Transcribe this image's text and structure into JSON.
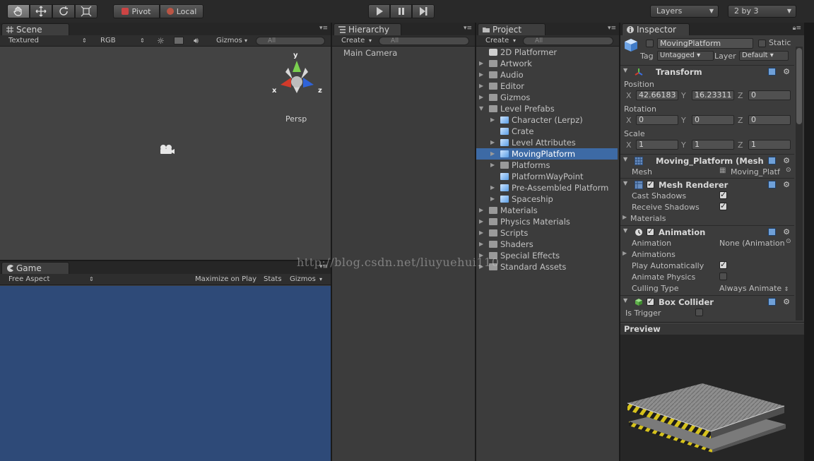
{
  "toolbar": {
    "pivot_label": "Pivot",
    "local_label": "Local",
    "layers_label": "Layers",
    "layout_label": "2 by 3"
  },
  "scene": {
    "tab_label": "Scene",
    "shading_mode": "Textured",
    "render_mode": "RGB",
    "gizmos_label": "Gizmos",
    "search_placeholder": "All",
    "view_label": "Persp",
    "axis_y": "y",
    "axis_x": "x",
    "axis_z": "z"
  },
  "game": {
    "tab_label": "Game",
    "aspect": "Free Aspect",
    "maximize_label": "Maximize on Play",
    "stats_label": "Stats",
    "gizmos_label": "Gizmos",
    "background_color": "#2e4a78"
  },
  "hierarchy": {
    "tab_label": "Hierarchy",
    "create_label": "Create",
    "search_placeholder": "All",
    "items": [
      "Main Camera"
    ]
  },
  "project": {
    "tab_label": "Project",
    "create_label": "Create",
    "search_placeholder": "All",
    "items": [
      {
        "label": "2D Platformer",
        "level": 0,
        "kind": "scene",
        "arrow": "none"
      },
      {
        "label": "Artwork",
        "level": 0,
        "kind": "folder",
        "arrow": "closed"
      },
      {
        "label": "Audio",
        "level": 0,
        "kind": "folder",
        "arrow": "closed"
      },
      {
        "label": "Editor",
        "level": 0,
        "kind": "folder",
        "arrow": "closed"
      },
      {
        "label": "Gizmos",
        "level": 0,
        "kind": "folder",
        "arrow": "closed"
      },
      {
        "label": "Level Prefabs",
        "level": 0,
        "kind": "folder",
        "arrow": "open"
      },
      {
        "label": "Character (Lerpz)",
        "level": 1,
        "kind": "prefab",
        "arrow": "closed"
      },
      {
        "label": "Crate",
        "level": 1,
        "kind": "prefab",
        "arrow": "none"
      },
      {
        "label": "Level Attributes",
        "level": 1,
        "kind": "prefab",
        "arrow": "closed"
      },
      {
        "label": "MovingPlatform",
        "level": 1,
        "kind": "prefab",
        "arrow": "closed",
        "selected": true
      },
      {
        "label": "Platforms",
        "level": 1,
        "kind": "folder",
        "arrow": "closed"
      },
      {
        "label": "PlatformWayPoint",
        "level": 1,
        "kind": "prefab",
        "arrow": "none"
      },
      {
        "label": "Pre-Assembled Platform",
        "level": 1,
        "kind": "prefab",
        "arrow": "closed"
      },
      {
        "label": "Spaceship",
        "level": 1,
        "kind": "prefab",
        "arrow": "closed"
      },
      {
        "label": "Materials",
        "level": 0,
        "kind": "folder",
        "arrow": "closed"
      },
      {
        "label": "Physics Materials",
        "level": 0,
        "kind": "folder",
        "arrow": "closed"
      },
      {
        "label": "Scripts",
        "level": 0,
        "kind": "folder",
        "arrow": "closed"
      },
      {
        "label": "Shaders",
        "level": 0,
        "kind": "folder",
        "arrow": "closed"
      },
      {
        "label": "Special Effects",
        "level": 0,
        "kind": "folder",
        "arrow": "closed"
      },
      {
        "label": "Standard Assets",
        "level": 0,
        "kind": "folder",
        "arrow": "closed"
      }
    ]
  },
  "inspector": {
    "tab_label": "Inspector",
    "object_name": "MovingPlatform",
    "static_label": "Static",
    "tag_label": "Tag",
    "tag_value": "Untagged",
    "layer_label": "Layer",
    "layer_value": "Default",
    "transform": {
      "title": "Transform",
      "position_label": "Position",
      "rotation_label": "Rotation",
      "scale_label": "Scale",
      "x": "X",
      "y": "Y",
      "z": "Z",
      "position": [
        "42.66183",
        "16.23311",
        "0"
      ],
      "rotation": [
        "0",
        "0",
        "0"
      ],
      "scale": [
        "1",
        "1",
        "1"
      ]
    },
    "mesh_filter": {
      "title": "Moving_Platform (Mesh",
      "mesh_label": "Mesh",
      "mesh_value": "Moving_Platf"
    },
    "mesh_renderer": {
      "title": "Mesh Renderer",
      "cast_shadows_label": "Cast Shadows",
      "receive_shadows_label": "Receive Shadows",
      "materials_label": "Materials"
    },
    "animation": {
      "title": "Animation",
      "animation_label": "Animation",
      "animation_value": "None (Animation",
      "animations_label": "Animations",
      "play_auto_label": "Play Automatically",
      "animate_physics_label": "Animate Physics",
      "culling_label": "Culling Type",
      "culling_value": "Always Animate"
    },
    "box_collider": {
      "title": "Box Collider",
      "is_trigger_label": "Is Trigger"
    },
    "preview_label": "Preview"
  },
  "watermark": "http://blog.csdn.net/liuyuehui110"
}
